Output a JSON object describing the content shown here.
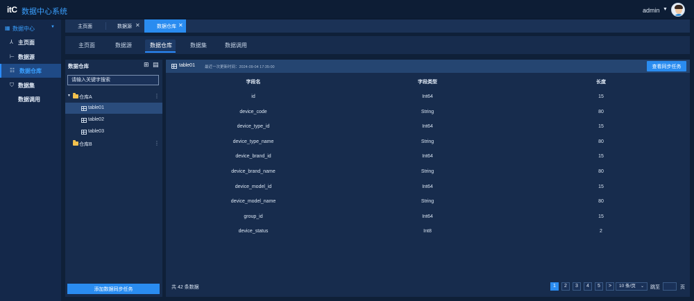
{
  "header": {
    "logo_text": "itC",
    "app_title": "数据中心系统",
    "user_name": "admin"
  },
  "sidebar": {
    "group_label": "数据中心",
    "items": [
      {
        "label": "主页面",
        "icon": "user-icon"
      },
      {
        "label": "数据源",
        "icon": "branch-icon"
      },
      {
        "label": "数据仓库",
        "icon": "list-icon"
      },
      {
        "label": "数据集",
        "icon": "shield-icon"
      },
      {
        "label": "数据调用",
        "icon": ""
      }
    ],
    "active_index": 2
  },
  "page_tabs": [
    {
      "label": "主页面",
      "closable": false
    },
    {
      "label": "数据源",
      "closable": true
    },
    {
      "label": "数据仓库",
      "closable": true
    }
  ],
  "sub_tabs": [
    "主页面",
    "数据源",
    "数据仓库",
    "数据集",
    "数据调用"
  ],
  "warehouse_panel": {
    "title": "数据仓库",
    "search_placeholder": "请输入关键字搜索",
    "tree": [
      {
        "label": "仓库A",
        "expanded": true,
        "children": [
          "table01",
          "table02",
          "table03"
        ]
      },
      {
        "label": "仓库B",
        "expanded": false,
        "children": []
      }
    ],
    "selected": "table01",
    "add_button": "添加数据同步任务"
  },
  "table_panel": {
    "table_name": "table01",
    "last_update": "最近一次更新时间：2024-09-04 17:35:00",
    "sync_button": "查看同步任务",
    "columns": [
      "字段名",
      "字段类型",
      "长度"
    ],
    "rows": [
      [
        "id",
        "Int64",
        "15"
      ],
      [
        "device_code",
        "String",
        "80"
      ],
      [
        "device_type_id",
        "Int64",
        "15"
      ],
      [
        "device_type_name",
        "String",
        "80"
      ],
      [
        "device_brand_id",
        "Int64",
        "15"
      ],
      [
        "device_brand_name",
        "String",
        "80"
      ],
      [
        "device_model_id",
        "Int64",
        "15"
      ],
      [
        "device_model_name",
        "String",
        "80"
      ],
      [
        "group_id",
        "Int64",
        "15"
      ],
      [
        "device_status",
        "Int8",
        "2"
      ]
    ],
    "total": "共 42 条数据",
    "pages": [
      "1",
      "2",
      "3",
      "4",
      "5"
    ],
    "current_page": "1",
    "next_label": ">",
    "page_size": "10 条/页",
    "jump_label": "跳至",
    "jump_unit": "页"
  }
}
